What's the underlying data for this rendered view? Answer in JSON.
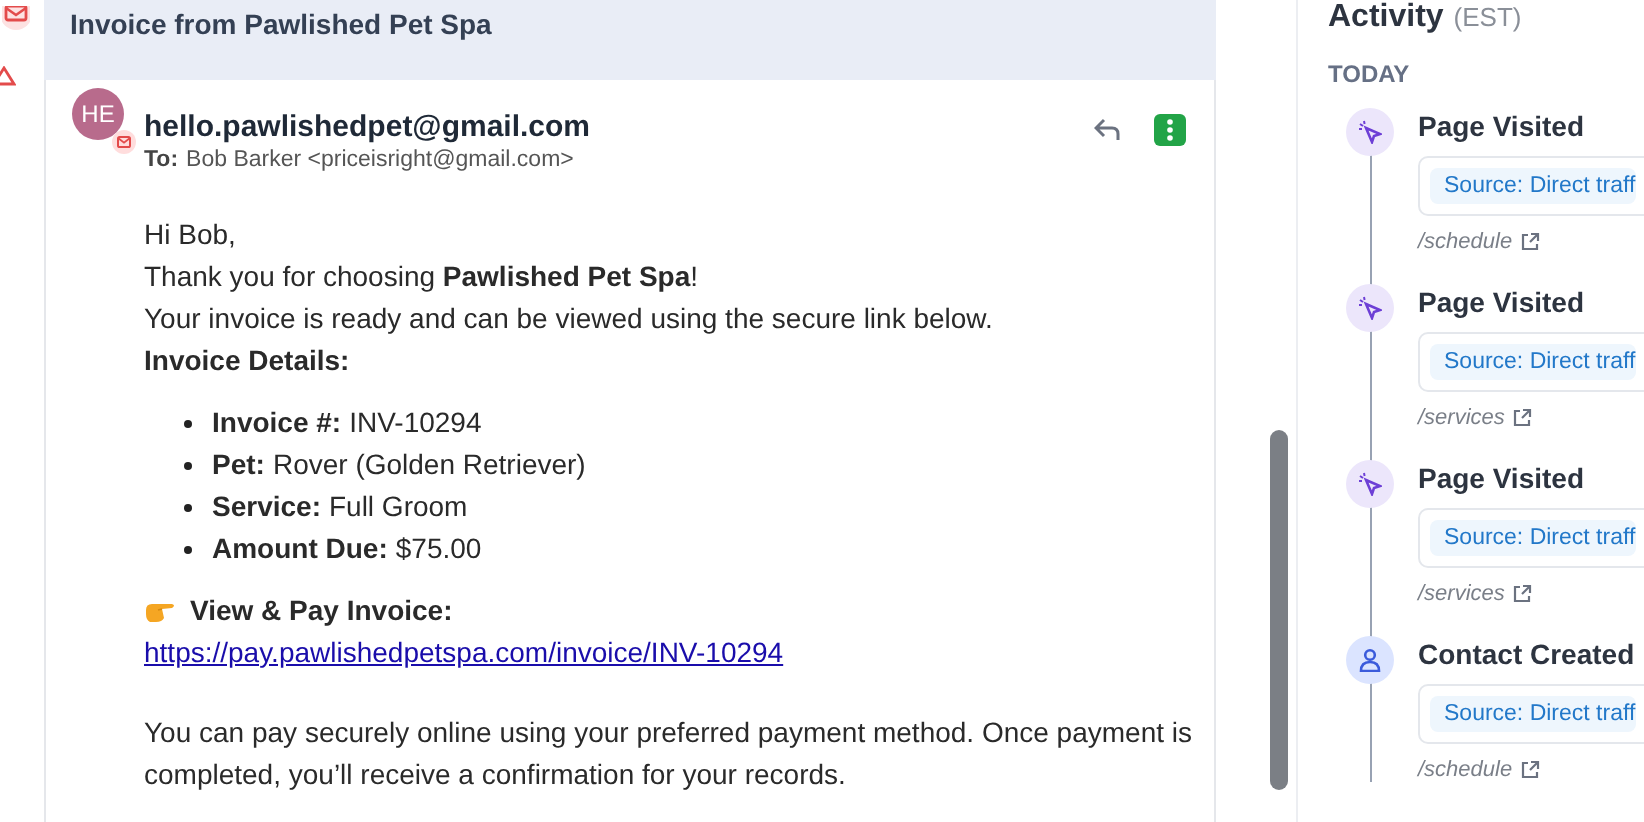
{
  "email": {
    "subject": "Invoice from Pawlished Pet Spa",
    "avatar": "HE",
    "from": "hello.pawlishedpet@gmail.com",
    "to_label": "To:",
    "to": "Bob Barker <priceisright@gmail.com>",
    "body": {
      "greeting": "Hi Bob,",
      "lines": [
        "Thank you for choosing **Pawlished Pet Spa**!",
        "Your invoice is ready and can be viewed using the secure link below."
      ],
      "details_heading": "Invoice Details:",
      "details": [
        {
          "label": "Invoice #:",
          "value": "INV-10294"
        },
        {
          "label": "Pet:",
          "value": "Rover (Golden Retriever)"
        },
        {
          "label": "Service:",
          "value": "Full Groom"
        },
        {
          "label": "Amount Due:",
          "value": "$75.00"
        }
      ],
      "cta": "View & Pay Invoice:",
      "link": "https://pay.pawlishedpetspa.com/invoice/INV-10294",
      "closing": "You can pay securely online using your preferred payment method. Once payment is completed, you’ll receive a confirmation for your records."
    }
  },
  "activity": {
    "title": "Activity",
    "timezone": "(EST)",
    "group": "TODAY",
    "events": [
      {
        "kind": "page",
        "title": "Page Visited",
        "source": "Source: Direct traff",
        "path": "/schedule"
      },
      {
        "kind": "page",
        "title": "Page Visited",
        "source": "Source: Direct traff",
        "path": "/services"
      },
      {
        "kind": "page",
        "title": "Page Visited",
        "source": "Source: Direct traff",
        "path": "/services"
      },
      {
        "kind": "contact",
        "title": "Contact Created",
        "source": "Source: Direct traff",
        "path": "/schedule"
      }
    ]
  }
}
